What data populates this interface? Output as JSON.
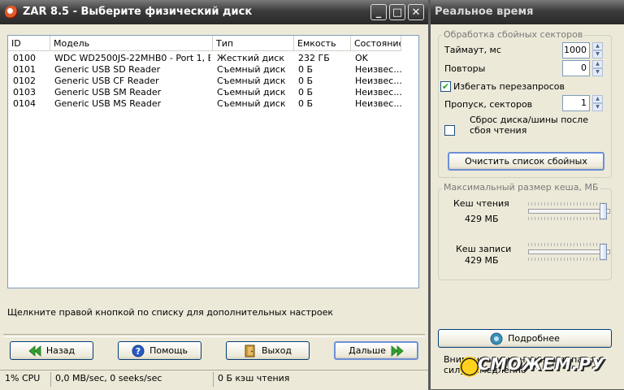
{
  "window": {
    "title": "ZAR 8.5 - Выберите физический диск",
    "controls": [
      "_",
      "□",
      "✕"
    ]
  },
  "disk_table": {
    "headers": [
      "ID",
      "Модель",
      "Тип",
      "Емкость",
      "Состояние"
    ],
    "rows": [
      [
        "0100",
        "WDC WD2500JS-22MHB0 - Port 1, B...",
        "Жесткий диск",
        "232 ГБ",
        "OK"
      ],
      [
        "0101",
        "Generic USB SD Reader",
        "Съемный диск",
        "0 Б",
        "Неизвес..."
      ],
      [
        "0102",
        "Generic USB CF Reader",
        "Съемный диск",
        "0 Б",
        "Неизвес..."
      ],
      [
        "0103",
        "Generic USB SM Reader",
        "Съемный диск",
        "0 Б",
        "Неизвес..."
      ],
      [
        "0104",
        "Generic USB MS Reader",
        "Съемный диск",
        "0 Б",
        "Неизвес..."
      ]
    ]
  },
  "hint": "Щелкните правой кнопкой по списку для дополнительных настроек",
  "buttons": {
    "back": "Назад",
    "help": "Помощь",
    "exit": "Выход",
    "next": "Дальше"
  },
  "status_bar": {
    "cpu": "1% CPU",
    "io": "0,0 MB/sec, 0 seeks/sec",
    "cache": "0 Б кэш чтения"
  },
  "realtime_panel": {
    "title": "Реальное время",
    "bad_sectors": {
      "group_label": "Обработка сбойных секторов",
      "timeout_label": "Таймаут, мс",
      "timeout_value": "1000",
      "retries_label": "Повторы",
      "retries_value": "0",
      "avoid_rereads_label": "Избегать перезапросов",
      "avoid_rereads_checked": true,
      "skip_label": "Пропуск, секторов",
      "skip_value": "1",
      "reset_label": "Сброс диска/шины после сбоя чтения",
      "reset_checked": false,
      "clear_button": "Очистить список сбойных"
    },
    "cache": {
      "group_label": "Максимальный размер кеша, МБ",
      "read_label": "Кеш чтения",
      "read_value": "429 МБ",
      "write_label": "Кеш записи",
      "write_value": "429 МБ"
    },
    "details_button": "Подробнее",
    "note": "Внимание: изменения вступают в силу немедленно",
    "watermark": "СМОЖЕМ.РУ"
  },
  "colors": {
    "titlebar": "#3b3b3b",
    "window_bg": "#ece9d8",
    "list_border": "#7f9db9",
    "arrow_green": "#2ea12e",
    "help_blue": "#2659c2"
  }
}
